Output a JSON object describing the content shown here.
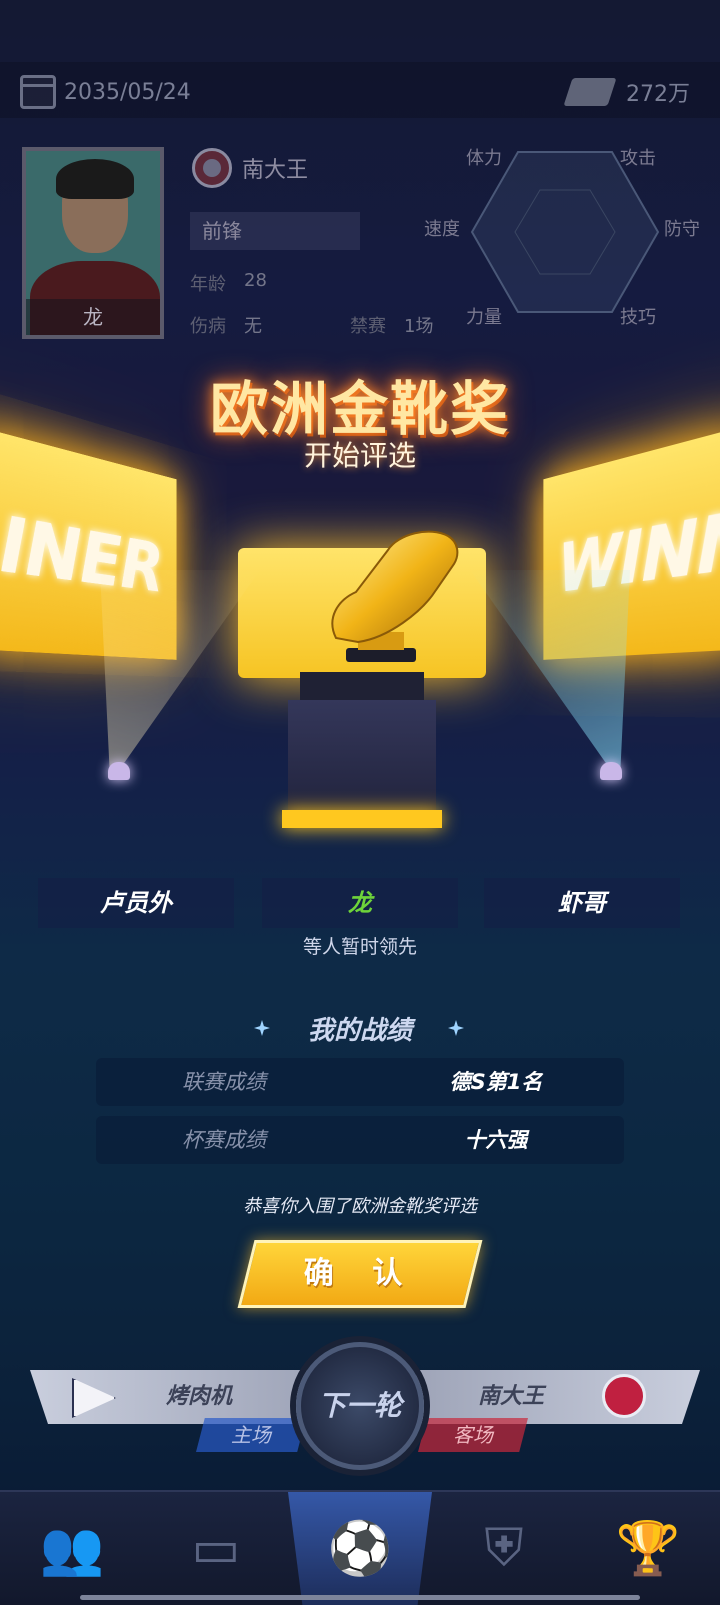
{
  "header": {
    "date": "2035/05/24",
    "money": "272万"
  },
  "player": {
    "name": "龙",
    "club": "南大王",
    "position": "前锋",
    "age_label": "年龄",
    "age": "28",
    "injury_label": "伤病",
    "injury": "无",
    "ban_label": "禁赛",
    "ban": "1场"
  },
  "radar": {
    "stamina": "体力",
    "attack": "攻击",
    "speed": "速度",
    "defense": "防守",
    "strength": "力量",
    "skill": "技巧"
  },
  "award": {
    "title": "欧洲金靴奖",
    "subtitle": "开始评选",
    "board_left": "INER",
    "board_right": "WINN",
    "leaders": [
      "卢员外",
      "龙",
      "虾哥"
    ],
    "leaders_note": "等人暂时领先"
  },
  "record": {
    "title": "我的战绩",
    "rows": [
      {
        "label": "联赛成绩",
        "value": "德S第1名"
      },
      {
        "label": "杯赛成绩",
        "value": "十六强"
      }
    ]
  },
  "congrats": "恭喜你入围了欧洲金靴奖评选",
  "confirm_label": "确 认",
  "match": {
    "home_team": "烤肉机",
    "home_tag": "主场",
    "away_team": "南大王",
    "away_tag": "客场",
    "next_label": "下一轮"
  },
  "nav": [
    "team-icon",
    "pitch-icon",
    "match-icon",
    "club-badge-icon",
    "trophy-icon"
  ],
  "colors": {
    "accent": "#ffc81f",
    "me": "#6ed33a",
    "home": "#285ac8",
    "away": "#c8283c"
  }
}
